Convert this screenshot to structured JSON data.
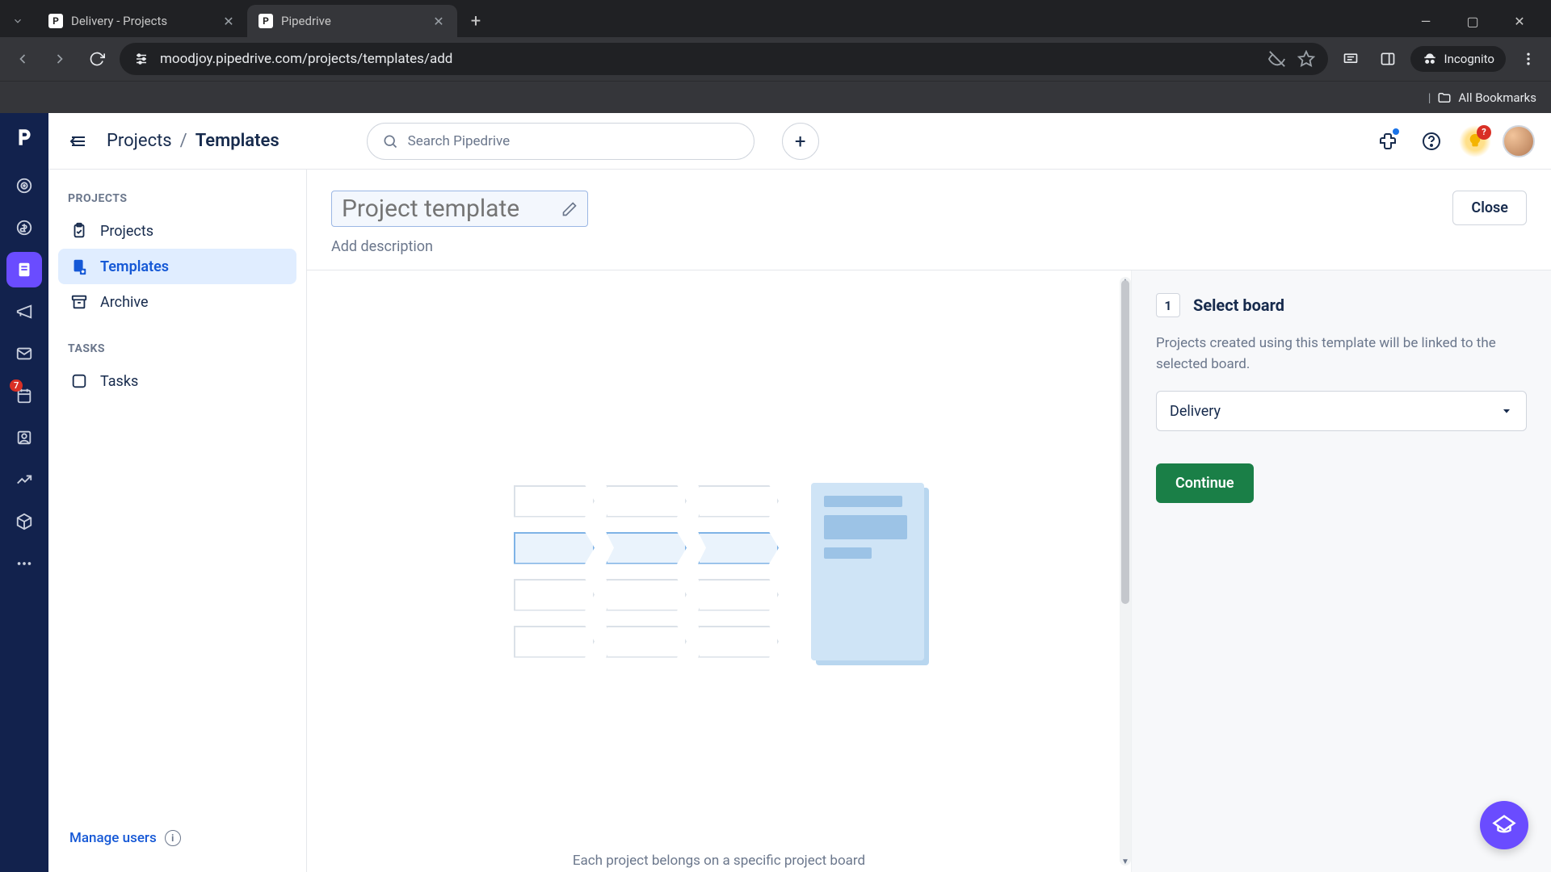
{
  "browser": {
    "tabs": [
      {
        "title": "Delivery - Projects",
        "favicon_letter": "P"
      },
      {
        "title": "Pipedrive",
        "favicon_letter": "P"
      }
    ],
    "active_tab_index": 1,
    "url": "moodjoy.pipedrive.com/projects/templates/add",
    "incognito_label": "Incognito",
    "all_bookmarks_label": "All Bookmarks"
  },
  "rail": {
    "items": [
      {
        "name": "nav-leads-icon"
      },
      {
        "name": "nav-deals-icon"
      },
      {
        "name": "nav-projects-icon"
      },
      {
        "name": "nav-campaigns-icon"
      },
      {
        "name": "nav-mail-icon"
      },
      {
        "name": "nav-activities-icon"
      },
      {
        "name": "nav-contacts-icon"
      },
      {
        "name": "nav-insights-icon"
      },
      {
        "name": "nav-products-icon"
      },
      {
        "name": "nav-more-icon"
      }
    ],
    "active_index": 2,
    "badge_index": 5,
    "badge_value": "7"
  },
  "header": {
    "breadcrumb_root": "Projects",
    "breadcrumb_current": "Templates",
    "search_placeholder": "Search Pipedrive",
    "bulb_badge": "?"
  },
  "sidebar": {
    "section_projects": "PROJECTS",
    "section_tasks": "TASKS",
    "items_projects": [
      {
        "label": "Projects"
      },
      {
        "label": "Templates"
      },
      {
        "label": "Archive"
      }
    ],
    "items_tasks": [
      {
        "label": "Tasks"
      }
    ],
    "selected_label": "Templates",
    "manage_users": "Manage users"
  },
  "content": {
    "title_placeholder": "Project template",
    "add_description": "Add description",
    "close_label": "Close",
    "caption": "Each project belongs on a specific project board"
  },
  "config": {
    "step_number": "1",
    "step_title": "Select board",
    "step_desc": "Projects created using this template will be linked to the selected board.",
    "select_value": "Delivery",
    "continue_label": "Continue"
  }
}
